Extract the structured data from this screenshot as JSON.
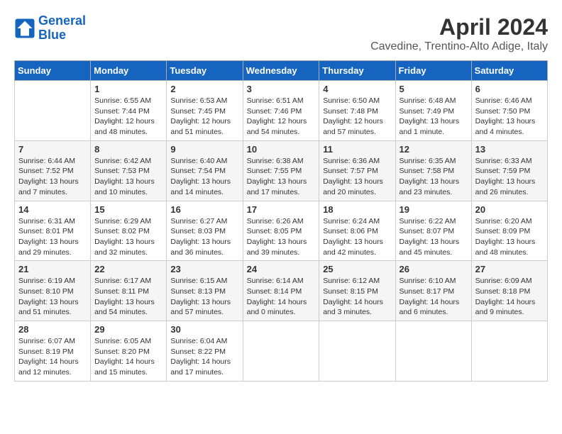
{
  "header": {
    "logo_line1": "General",
    "logo_line2": "Blue",
    "month_title": "April 2024",
    "subtitle": "Cavedine, Trentino-Alto Adige, Italy"
  },
  "days_of_week": [
    "Sunday",
    "Monday",
    "Tuesday",
    "Wednesday",
    "Thursday",
    "Friday",
    "Saturday"
  ],
  "weeks": [
    [
      {
        "num": "",
        "info": ""
      },
      {
        "num": "1",
        "info": "Sunrise: 6:55 AM\nSunset: 7:44 PM\nDaylight: 12 hours\nand 48 minutes."
      },
      {
        "num": "2",
        "info": "Sunrise: 6:53 AM\nSunset: 7:45 PM\nDaylight: 12 hours\nand 51 minutes."
      },
      {
        "num": "3",
        "info": "Sunrise: 6:51 AM\nSunset: 7:46 PM\nDaylight: 12 hours\nand 54 minutes."
      },
      {
        "num": "4",
        "info": "Sunrise: 6:50 AM\nSunset: 7:48 PM\nDaylight: 12 hours\nand 57 minutes."
      },
      {
        "num": "5",
        "info": "Sunrise: 6:48 AM\nSunset: 7:49 PM\nDaylight: 13 hours\nand 1 minute."
      },
      {
        "num": "6",
        "info": "Sunrise: 6:46 AM\nSunset: 7:50 PM\nDaylight: 13 hours\nand 4 minutes."
      }
    ],
    [
      {
        "num": "7",
        "info": "Sunrise: 6:44 AM\nSunset: 7:52 PM\nDaylight: 13 hours\nand 7 minutes."
      },
      {
        "num": "8",
        "info": "Sunrise: 6:42 AM\nSunset: 7:53 PM\nDaylight: 13 hours\nand 10 minutes."
      },
      {
        "num": "9",
        "info": "Sunrise: 6:40 AM\nSunset: 7:54 PM\nDaylight: 13 hours\nand 14 minutes."
      },
      {
        "num": "10",
        "info": "Sunrise: 6:38 AM\nSunset: 7:55 PM\nDaylight: 13 hours\nand 17 minutes."
      },
      {
        "num": "11",
        "info": "Sunrise: 6:36 AM\nSunset: 7:57 PM\nDaylight: 13 hours\nand 20 minutes."
      },
      {
        "num": "12",
        "info": "Sunrise: 6:35 AM\nSunset: 7:58 PM\nDaylight: 13 hours\nand 23 minutes."
      },
      {
        "num": "13",
        "info": "Sunrise: 6:33 AM\nSunset: 7:59 PM\nDaylight: 13 hours\nand 26 minutes."
      }
    ],
    [
      {
        "num": "14",
        "info": "Sunrise: 6:31 AM\nSunset: 8:01 PM\nDaylight: 13 hours\nand 29 minutes."
      },
      {
        "num": "15",
        "info": "Sunrise: 6:29 AM\nSunset: 8:02 PM\nDaylight: 13 hours\nand 32 minutes."
      },
      {
        "num": "16",
        "info": "Sunrise: 6:27 AM\nSunset: 8:03 PM\nDaylight: 13 hours\nand 36 minutes."
      },
      {
        "num": "17",
        "info": "Sunrise: 6:26 AM\nSunset: 8:05 PM\nDaylight: 13 hours\nand 39 minutes."
      },
      {
        "num": "18",
        "info": "Sunrise: 6:24 AM\nSunset: 8:06 PM\nDaylight: 13 hours\nand 42 minutes."
      },
      {
        "num": "19",
        "info": "Sunrise: 6:22 AM\nSunset: 8:07 PM\nDaylight: 13 hours\nand 45 minutes."
      },
      {
        "num": "20",
        "info": "Sunrise: 6:20 AM\nSunset: 8:09 PM\nDaylight: 13 hours\nand 48 minutes."
      }
    ],
    [
      {
        "num": "21",
        "info": "Sunrise: 6:19 AM\nSunset: 8:10 PM\nDaylight: 13 hours\nand 51 minutes."
      },
      {
        "num": "22",
        "info": "Sunrise: 6:17 AM\nSunset: 8:11 PM\nDaylight: 13 hours\nand 54 minutes."
      },
      {
        "num": "23",
        "info": "Sunrise: 6:15 AM\nSunset: 8:13 PM\nDaylight: 13 hours\nand 57 minutes."
      },
      {
        "num": "24",
        "info": "Sunrise: 6:14 AM\nSunset: 8:14 PM\nDaylight: 14 hours\nand 0 minutes."
      },
      {
        "num": "25",
        "info": "Sunrise: 6:12 AM\nSunset: 8:15 PM\nDaylight: 14 hours\nand 3 minutes."
      },
      {
        "num": "26",
        "info": "Sunrise: 6:10 AM\nSunset: 8:17 PM\nDaylight: 14 hours\nand 6 minutes."
      },
      {
        "num": "27",
        "info": "Sunrise: 6:09 AM\nSunset: 8:18 PM\nDaylight: 14 hours\nand 9 minutes."
      }
    ],
    [
      {
        "num": "28",
        "info": "Sunrise: 6:07 AM\nSunset: 8:19 PM\nDaylight: 14 hours\nand 12 minutes."
      },
      {
        "num": "29",
        "info": "Sunrise: 6:05 AM\nSunset: 8:20 PM\nDaylight: 14 hours\nand 15 minutes."
      },
      {
        "num": "30",
        "info": "Sunrise: 6:04 AM\nSunset: 8:22 PM\nDaylight: 14 hours\nand 17 minutes."
      },
      {
        "num": "",
        "info": ""
      },
      {
        "num": "",
        "info": ""
      },
      {
        "num": "",
        "info": ""
      },
      {
        "num": "",
        "info": ""
      }
    ]
  ]
}
